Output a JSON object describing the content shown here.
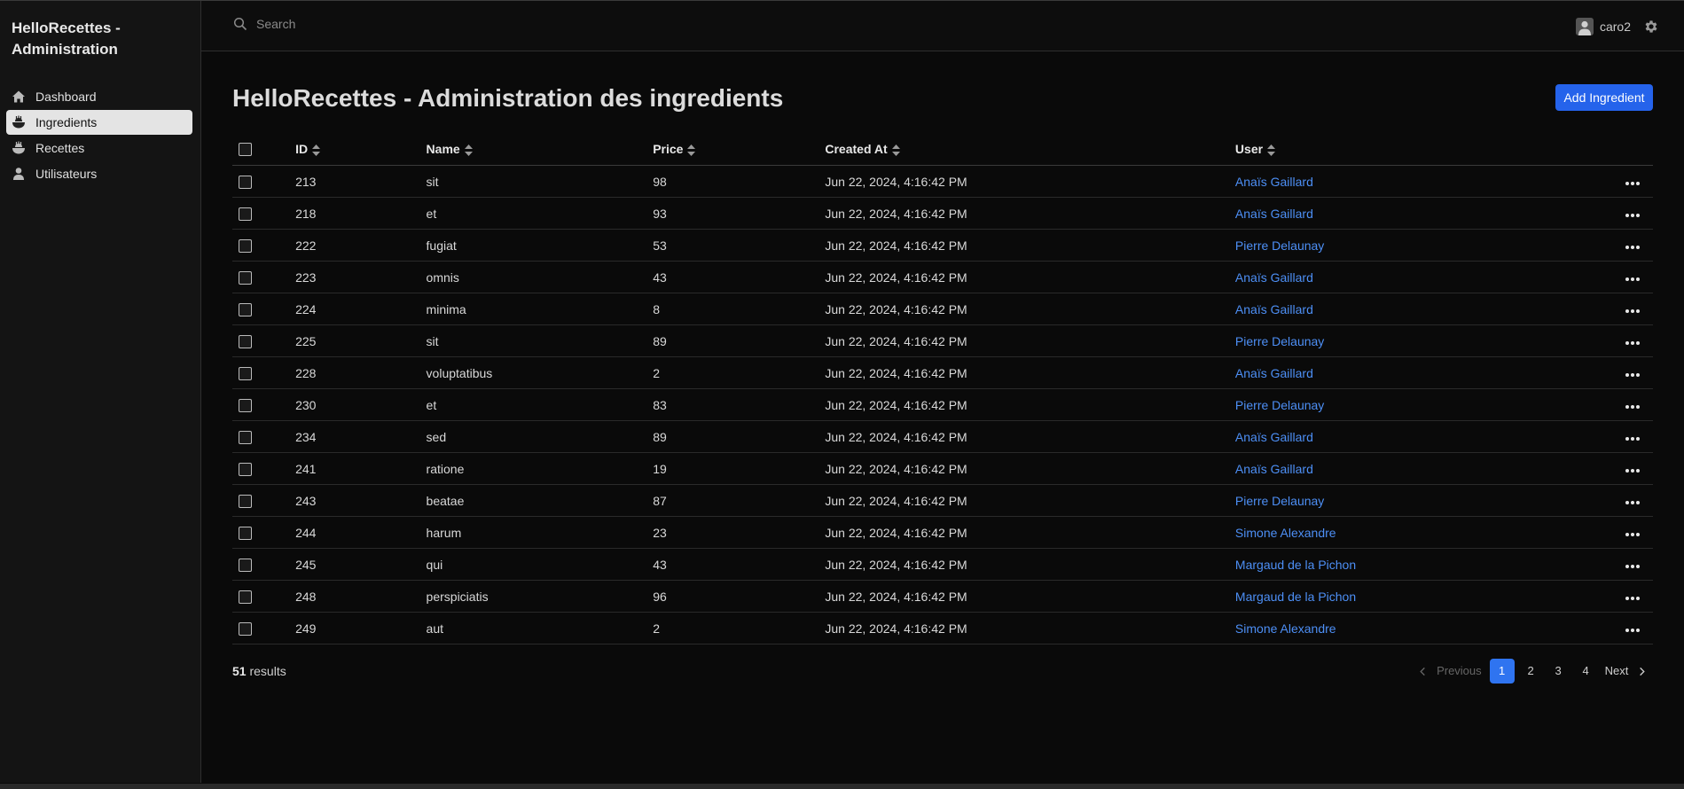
{
  "app": {
    "brand": "HelloRecettes - Administration"
  },
  "sidebar": {
    "items": [
      {
        "label": "Dashboard",
        "icon": "home-icon",
        "active": false
      },
      {
        "label": "Ingredients",
        "icon": "bowl-icon",
        "active": true
      },
      {
        "label": "Recettes",
        "icon": "bowl-icon",
        "active": false
      },
      {
        "label": "Utilisateurs",
        "icon": "user-icon",
        "active": false
      }
    ]
  },
  "header": {
    "search_placeholder": "Search",
    "username": "caro2"
  },
  "main": {
    "title": "HelloRecettes - Administration des ingredients",
    "add_button": "Add Ingredient"
  },
  "table": {
    "columns": {
      "id": "ID",
      "name": "Name",
      "price": "Price",
      "created_at": "Created At",
      "user": "User"
    },
    "rows": [
      {
        "id": "213",
        "name": "sit",
        "price": "98",
        "created_at": "Jun 22, 2024, 4:16:42 PM",
        "user": "Anaïs Gaillard"
      },
      {
        "id": "218",
        "name": "et",
        "price": "93",
        "created_at": "Jun 22, 2024, 4:16:42 PM",
        "user": "Anaïs Gaillard"
      },
      {
        "id": "222",
        "name": "fugiat",
        "price": "53",
        "created_at": "Jun 22, 2024, 4:16:42 PM",
        "user": "Pierre Delaunay"
      },
      {
        "id": "223",
        "name": "omnis",
        "price": "43",
        "created_at": "Jun 22, 2024, 4:16:42 PM",
        "user": "Anaïs Gaillard"
      },
      {
        "id": "224",
        "name": "minima",
        "price": "8",
        "created_at": "Jun 22, 2024, 4:16:42 PM",
        "user": "Anaïs Gaillard"
      },
      {
        "id": "225",
        "name": "sit",
        "price": "89",
        "created_at": "Jun 22, 2024, 4:16:42 PM",
        "user": "Pierre Delaunay"
      },
      {
        "id": "228",
        "name": "voluptatibus",
        "price": "2",
        "created_at": "Jun 22, 2024, 4:16:42 PM",
        "user": "Anaïs Gaillard"
      },
      {
        "id": "230",
        "name": "et",
        "price": "83",
        "created_at": "Jun 22, 2024, 4:16:42 PM",
        "user": "Pierre Delaunay"
      },
      {
        "id": "234",
        "name": "sed",
        "price": "89",
        "created_at": "Jun 22, 2024, 4:16:42 PM",
        "user": "Anaïs Gaillard"
      },
      {
        "id": "241",
        "name": "ratione",
        "price": "19",
        "created_at": "Jun 22, 2024, 4:16:42 PM",
        "user": "Anaïs Gaillard"
      },
      {
        "id": "243",
        "name": "beatae",
        "price": "87",
        "created_at": "Jun 22, 2024, 4:16:42 PM",
        "user": "Pierre Delaunay"
      },
      {
        "id": "244",
        "name": "harum",
        "price": "23",
        "created_at": "Jun 22, 2024, 4:16:42 PM",
        "user": "Simone Alexandre"
      },
      {
        "id": "245",
        "name": "qui",
        "price": "43",
        "created_at": "Jun 22, 2024, 4:16:42 PM",
        "user": "Margaud de la Pichon"
      },
      {
        "id": "248",
        "name": "perspiciatis",
        "price": "96",
        "created_at": "Jun 22, 2024, 4:16:42 PM",
        "user": "Margaud de la Pichon"
      },
      {
        "id": "249",
        "name": "aut",
        "price": "2",
        "created_at": "Jun 22, 2024, 4:16:42 PM",
        "user": "Simone Alexandre"
      }
    ]
  },
  "footer": {
    "results_count": "51",
    "results_label": "results",
    "previous": "Previous",
    "next": "Next",
    "pages": [
      "1",
      "2",
      "3",
      "4"
    ],
    "current_page": "1"
  },
  "colors": {
    "accent": "#2563eb",
    "link": "#4d8ff5",
    "background": "#0a0a0a",
    "sidebar": "#141414"
  }
}
